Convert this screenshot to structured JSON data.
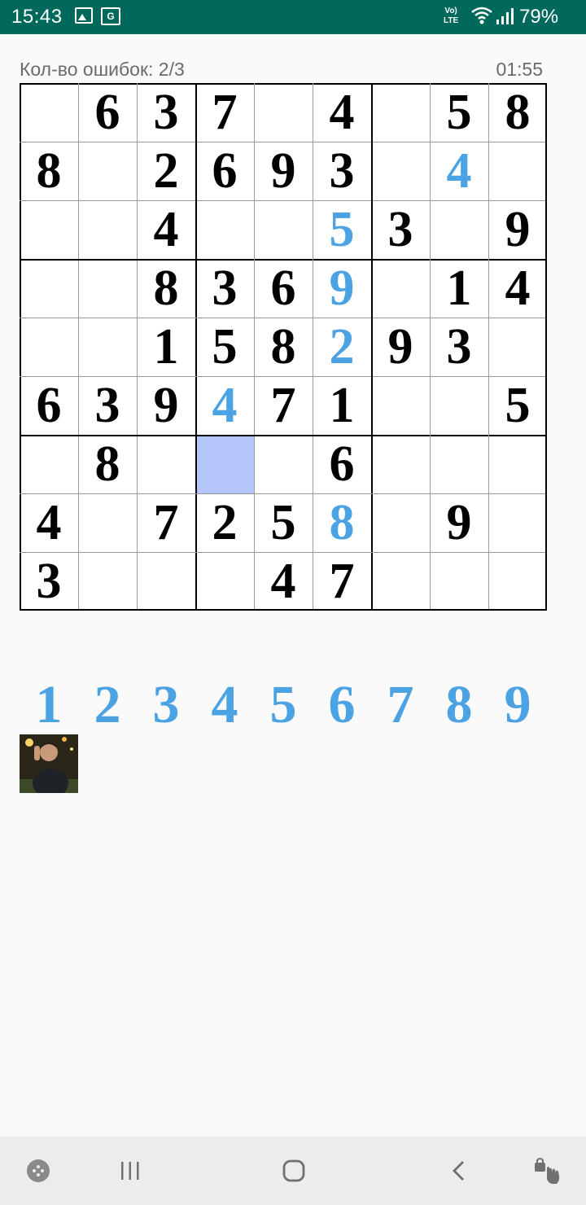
{
  "status_bar": {
    "time": "15:43",
    "network": "Vo)) LTE",
    "battery": "79%",
    "icons": [
      "gallery-icon",
      "translate-icon",
      "wifi-icon",
      "signal-icon"
    ]
  },
  "game": {
    "errors_text": "Кол-во ошибок: 2/3",
    "timer": "01:55"
  },
  "grid": [
    [
      {
        "v": ""
      },
      {
        "v": "6"
      },
      {
        "v": "3"
      },
      {
        "v": "7"
      },
      {
        "v": ""
      },
      {
        "v": "4"
      },
      {
        "v": ""
      },
      {
        "v": "5"
      },
      {
        "v": "8"
      }
    ],
    [
      {
        "v": "8"
      },
      {
        "v": ""
      },
      {
        "v": "2"
      },
      {
        "v": "6"
      },
      {
        "v": "9"
      },
      {
        "v": "3"
      },
      {
        "v": ""
      },
      {
        "v": "4",
        "user": true
      },
      {
        "v": ""
      }
    ],
    [
      {
        "v": ""
      },
      {
        "v": ""
      },
      {
        "v": "4"
      },
      {
        "v": ""
      },
      {
        "v": ""
      },
      {
        "v": "5",
        "user": true
      },
      {
        "v": "3"
      },
      {
        "v": ""
      },
      {
        "v": "9"
      }
    ],
    [
      {
        "v": ""
      },
      {
        "v": ""
      },
      {
        "v": "8"
      },
      {
        "v": "3"
      },
      {
        "v": "6"
      },
      {
        "v": "9",
        "user": true
      },
      {
        "v": ""
      },
      {
        "v": "1"
      },
      {
        "v": "4"
      }
    ],
    [
      {
        "v": ""
      },
      {
        "v": ""
      },
      {
        "v": "1"
      },
      {
        "v": "5"
      },
      {
        "v": "8"
      },
      {
        "v": "2",
        "user": true
      },
      {
        "v": "9"
      },
      {
        "v": "3"
      },
      {
        "v": ""
      }
    ],
    [
      {
        "v": "6"
      },
      {
        "v": "3"
      },
      {
        "v": "9"
      },
      {
        "v": "4",
        "user": true
      },
      {
        "v": "7"
      },
      {
        "v": "1"
      },
      {
        "v": ""
      },
      {
        "v": ""
      },
      {
        "v": "5"
      }
    ],
    [
      {
        "v": ""
      },
      {
        "v": "8"
      },
      {
        "v": ""
      },
      {
        "v": "",
        "selected": true
      },
      {
        "v": ""
      },
      {
        "v": "6"
      },
      {
        "v": ""
      },
      {
        "v": ""
      },
      {
        "v": ""
      }
    ],
    [
      {
        "v": "4"
      },
      {
        "v": ""
      },
      {
        "v": "7"
      },
      {
        "v": "2"
      },
      {
        "v": "5"
      },
      {
        "v": "8",
        "user": true
      },
      {
        "v": ""
      },
      {
        "v": "9"
      },
      {
        "v": ""
      }
    ],
    [
      {
        "v": "3"
      },
      {
        "v": ""
      },
      {
        "v": ""
      },
      {
        "v": ""
      },
      {
        "v": "4"
      },
      {
        "v": "7"
      },
      {
        "v": ""
      },
      {
        "v": ""
      },
      {
        "v": ""
      }
    ]
  ],
  "numpad": [
    "1",
    "2",
    "3",
    "4",
    "5",
    "6",
    "7",
    "8",
    "9"
  ],
  "colors": {
    "status_bar": "#00695c",
    "given_digit": "#000000",
    "user_digit": "#4ba3e3",
    "selected_cell": "#b5c7fc"
  },
  "navbar": {
    "buttons": [
      "game-tools-icon",
      "recent-apps-icon",
      "home-icon",
      "back-icon",
      "accessibility-icon"
    ]
  }
}
